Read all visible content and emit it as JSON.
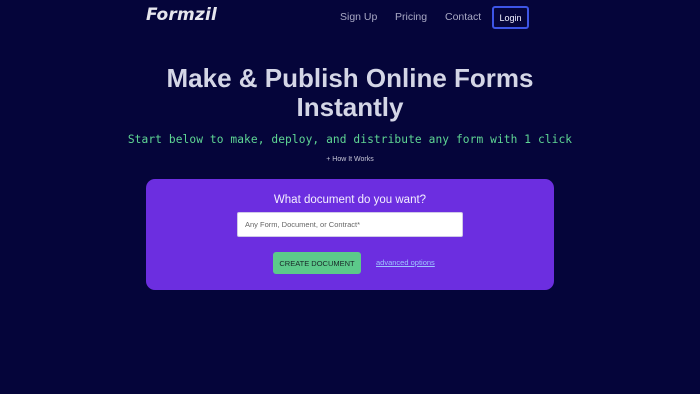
{
  "nav": {
    "logo": "Formzil",
    "links": [
      "Sign Up",
      "Pricing",
      "Contact"
    ],
    "login_label": "Login"
  },
  "hero": {
    "title_line1": "Make & Publish Online Forms",
    "title_line2": "Instantly",
    "subtitle": "Start below to make, deploy, and distribute any form with 1 click",
    "how_it_works": "+ How It Works"
  },
  "card": {
    "heading": "What document do you want?",
    "input_placeholder": "Any Form, Document, or Contract*",
    "input_value": "",
    "create_label": "CREATE DOCUMENT",
    "advanced_label": "advanced options"
  },
  "colors": {
    "background": "#05053a",
    "card": "#6c2ee0",
    "accent_green": "#5cc98a",
    "login_border": "#3d55e6"
  }
}
